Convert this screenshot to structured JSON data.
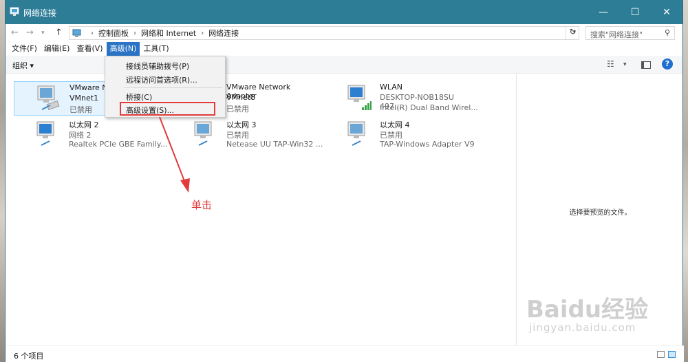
{
  "window": {
    "title": "网络连接",
    "min_glyph": "—",
    "max_glyph": "☐",
    "close_glyph": "✕"
  },
  "address": {
    "crumbs": [
      "控制面板",
      "网络和 Internet",
      "网络连接"
    ],
    "search_placeholder": "搜索\"网络连接\""
  },
  "menubar": {
    "items": [
      "文件(F)",
      "编辑(E)",
      "查看(V)",
      "高级(N)",
      "工具(T)"
    ],
    "active_index": 3
  },
  "toolbar": {
    "organize_label": "组织 ▾"
  },
  "dropdown": {
    "items": [
      "接线员辅助拨号(P)",
      "远程访问首选项(R)...",
      "桥接(C)",
      "高级设置(S)..."
    ]
  },
  "adapters": [
    {
      "name": "VMware N",
      "net": "VMnet1",
      "status": "已禁用",
      "selected": true
    },
    {
      "name": "VMware Network Adapter",
      "net": "VMnet8",
      "status": "已禁用"
    },
    {
      "name": "WLAN",
      "net": "DESKTOP-NOB18SU 497...",
      "status": "Intel(R) Dual Band Wirel..."
    },
    {
      "name": "以太网 2",
      "net": "网络  2",
      "status": "Realtek PCIe GBE Family..."
    },
    {
      "name": "以太网 3",
      "net": "已禁用",
      "status": "Netease UU TAP-Win32 ..."
    },
    {
      "name": "以太网 4",
      "net": "已禁用",
      "status": "TAP-Windows Adapter V9"
    }
  ],
  "preview": {
    "text": "选择要预览的文件。"
  },
  "annotation": {
    "text": "单击"
  },
  "statusbar": {
    "count": "6 个项目"
  },
  "watermark": {
    "logo": "Baidu经验",
    "url": "jingyan.baidu.com"
  },
  "colors": {
    "titlebar": "#2e7d97",
    "menu_active": "#2a73c5",
    "highlight": "#e23b3b"
  }
}
